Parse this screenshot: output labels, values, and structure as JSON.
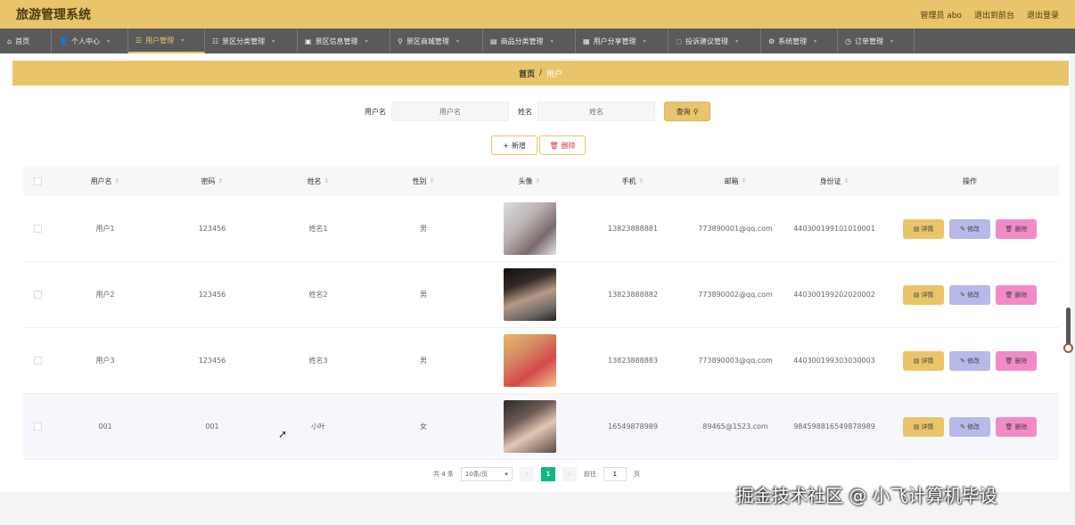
{
  "app": {
    "title": "旅游管理系统",
    "admin": "管理员 abo",
    "to_front": "退出到前台",
    "logout": "退出登录"
  },
  "nav": [
    {
      "label": "首页",
      "icon": "home-icon"
    },
    {
      "label": "个人中心",
      "icon": "user-icon"
    },
    {
      "label": "用户管理",
      "icon": "list-icon",
      "active": true
    },
    {
      "label": "景区分类管理",
      "icon": "menu-icon"
    },
    {
      "label": "景区信息管理",
      "icon": "scenic-icon"
    },
    {
      "label": "景区商城管理",
      "icon": "location-icon"
    },
    {
      "label": "商品分类管理",
      "icon": "doc-icon"
    },
    {
      "label": "用户分享管理",
      "icon": "share-icon"
    },
    {
      "label": "投诉建议管理",
      "icon": "chat-icon"
    },
    {
      "label": "系统管理",
      "icon": "setting-icon"
    },
    {
      "label": "订单管理",
      "icon": "order-icon"
    }
  ],
  "breadcrumb": {
    "home": "首页",
    "sep": "/",
    "current": "用户"
  },
  "search": {
    "username_label": "用户名",
    "username_placeholder": "用户名",
    "name_label": "姓名",
    "name_placeholder": "姓名",
    "query": "查询"
  },
  "actions": {
    "add": "新增",
    "delete": "删除"
  },
  "table": {
    "headers": [
      "用户名",
      "密码",
      "姓名",
      "性别",
      "头像",
      "手机",
      "邮箱",
      "身份证",
      "操作"
    ],
    "rows": [
      {
        "username": "用户1",
        "password": "123456",
        "name": "姓名1",
        "sex": "男",
        "phone": "13823888881",
        "email": "773890001@qq.com",
        "idcard": "440300199101010001"
      },
      {
        "username": "用户2",
        "password": "123456",
        "name": "姓名2",
        "sex": "男",
        "phone": "13823888882",
        "email": "773890002@qq.com",
        "idcard": "440300199202020002"
      },
      {
        "username": "用户3",
        "password": "123456",
        "name": "姓名3",
        "sex": "男",
        "phone": "13823888883",
        "email": "773890003@qq.com",
        "idcard": "440300199303030003"
      },
      {
        "username": "001",
        "password": "001",
        "name": "小叶",
        "sex": "女",
        "phone": "16549878989",
        "email": "89465@1523.com",
        "idcard": "984598816549878989"
      }
    ],
    "op_detail": "详情",
    "op_edit": "修改",
    "op_delete": "删除"
  },
  "pager": {
    "total": "共 4 条",
    "size": "10条/页",
    "current": "1",
    "goto": "前往",
    "goto_value": "1",
    "page_unit": "页"
  },
  "watermark": "掘金技术社区 @ 小飞计算机毕设"
}
